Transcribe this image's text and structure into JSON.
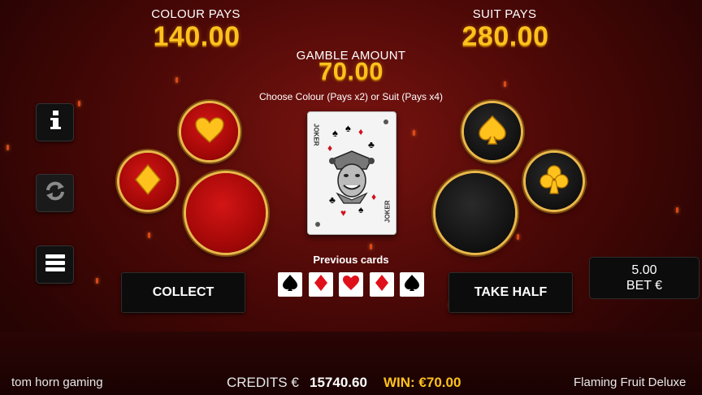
{
  "header": {
    "colour_pays_label": "COLOUR PAYS",
    "colour_pays_value": "140.00",
    "suit_pays_label": "SUIT PAYS",
    "suit_pays_value": "280.00",
    "gamble_amount_label": "GAMBLE AMOUNT",
    "gamble_amount_value": "70.00",
    "instruction": "Choose Colour (Pays x2) or Suit (Pays x4)"
  },
  "side_buttons": [
    {
      "icon": "info-icon"
    },
    {
      "icon": "refresh-icon"
    },
    {
      "icon": "menu-icon"
    }
  ],
  "card": {
    "corner_text": "JOKER",
    "face": "joker"
  },
  "previous": {
    "label": "Previous cards",
    "cards": [
      {
        "suit": "spade",
        "color": "#000000"
      },
      {
        "suit": "diamond",
        "color": "#e0101a"
      },
      {
        "suit": "heart",
        "color": "#e0101a"
      },
      {
        "suit": "diamond",
        "color": "#e0101a"
      },
      {
        "suit": "spade",
        "color": "#000000"
      }
    ]
  },
  "actions": {
    "collect_label": "COLLECT",
    "take_half_label": "TAKE HALF"
  },
  "bet": {
    "amount": "5.00",
    "label": "BET €"
  },
  "footer": {
    "brand": "tom horn gaming",
    "credits_label": "CREDITS €",
    "credits_value": "15740.60",
    "win_text": "WIN: €70.00",
    "game_name": "Flaming Fruit Deluxe"
  },
  "colors": {
    "gold": "#ffc21c",
    "red_suit": "#e0101a",
    "background": "#4a0806"
  }
}
